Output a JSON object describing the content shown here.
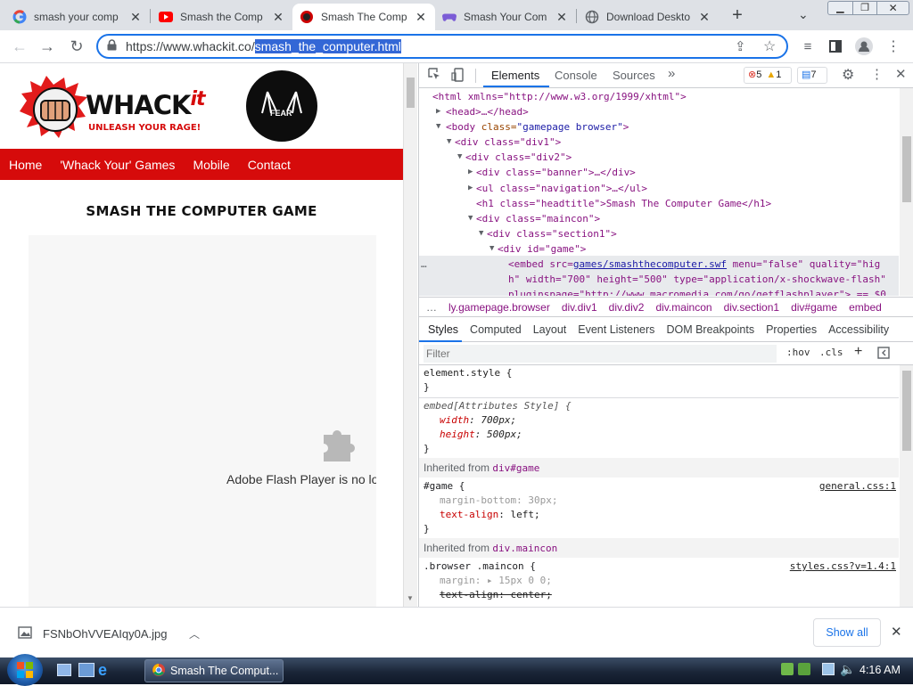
{
  "browser": {
    "tabs": [
      {
        "title": "smash your comp",
        "icon": "google-icon"
      },
      {
        "title": "Smash the Comp",
        "icon": "youtube-icon"
      },
      {
        "title": "Smash The Comp",
        "icon": "whackit-icon",
        "active": true
      },
      {
        "title": "Smash Your Com",
        "icon": "gamepad-icon"
      },
      {
        "title": "Download Deskto",
        "icon": "globe-icon"
      }
    ],
    "new_tab": "+",
    "url_host": "https://www.whackit.co/",
    "url_path": "smash_the_computer.html"
  },
  "site": {
    "logo_text": "WHACK",
    "logo_it": "it",
    "tagline": "UNLEASH YOUR RAGE!",
    "fear_text": "FEAR",
    "nav": [
      "Home",
      "'Whack Your' Games",
      "Mobile",
      "Contact"
    ],
    "headtitle": "SMASH THE COMPUTER GAME",
    "flash_message": "Adobe Flash Player is no lor"
  },
  "devtools": {
    "tabs": [
      "Elements",
      "Console",
      "Sources"
    ],
    "more": "»",
    "errors": "5",
    "warnings": "1",
    "messages": "7",
    "dom": {
      "l1": "<html xmlns=\"http://www.w3.org/1999/xhtml\">",
      "l2": "<head>…</head>",
      "l3_tag": "<body",
      "l3_attr": " class=",
      "l3_val": "\"gamepage browser\"",
      "l4": "<div class=\"div1\">",
      "l5": "<div class=\"div2\">",
      "l6": "<div class=\"banner\">…</div>",
      "l7": "<ul class=\"navigation\">…</ul>",
      "l8": "<h1 class=\"headtitle\">Smash The Computer Game</h1>",
      "l9": "<div class=\"maincon\">",
      "l10": "<div class=\"section1\">",
      "l11": "<div id=\"game\">",
      "l12a": "<embed src=",
      "l12b": "games/smashthecomputer.swf",
      "l12c": " menu=\"false\" quality=\"hig",
      "l13": "h\" width=\"700\" height=\"500\" type=\"application/x-shockwave-flash\"",
      "l14": "pluginspage=\"http://www.macromedia.com/go/getflashplayer\"> == $0"
    },
    "breadcrumbs": [
      "ly.gamepage.browser",
      "div.div1",
      "div.div2",
      "div.maincon",
      "div.section1",
      "div#game",
      "embed"
    ],
    "subtabs": [
      "Styles",
      "Computed",
      "Layout",
      "Event Listeners",
      "DOM Breakpoints",
      "Properties",
      "Accessibility"
    ],
    "filter_placeholder": "Filter",
    "hov": ":hov",
    "cls": ".cls",
    "styles": {
      "element_style": "element.style {",
      "close": "}",
      "embed_sel": "embed[Attributes Style] {",
      "width_prop": "width",
      "width_val": "700px;",
      "height_prop": "height",
      "height_val": "500px;",
      "inh1_label": "Inherited from ",
      "inh1_sel": "div#game",
      "game_sel": "#game {",
      "game_src": "general.css:1",
      "mb_prop": "margin-bottom",
      "mb_val": "30px;",
      "ta_prop": "text-align",
      "ta_val": "left;",
      "inh2_sel": "div.maincon",
      "maincon_sel": ".browser .maincon {",
      "maincon_src": "styles.css?v=1.4:1",
      "margin_prop": "margin",
      "margin_val": "▸ 15px 0 0;",
      "tac_text": "text-align: center;"
    }
  },
  "download": {
    "filename": "FSNbOhVVEAIqy0A.jpg",
    "show_all": "Show all"
  },
  "taskbar": {
    "window_title": "Smash The Comput...",
    "clock": "4:16 AM"
  }
}
